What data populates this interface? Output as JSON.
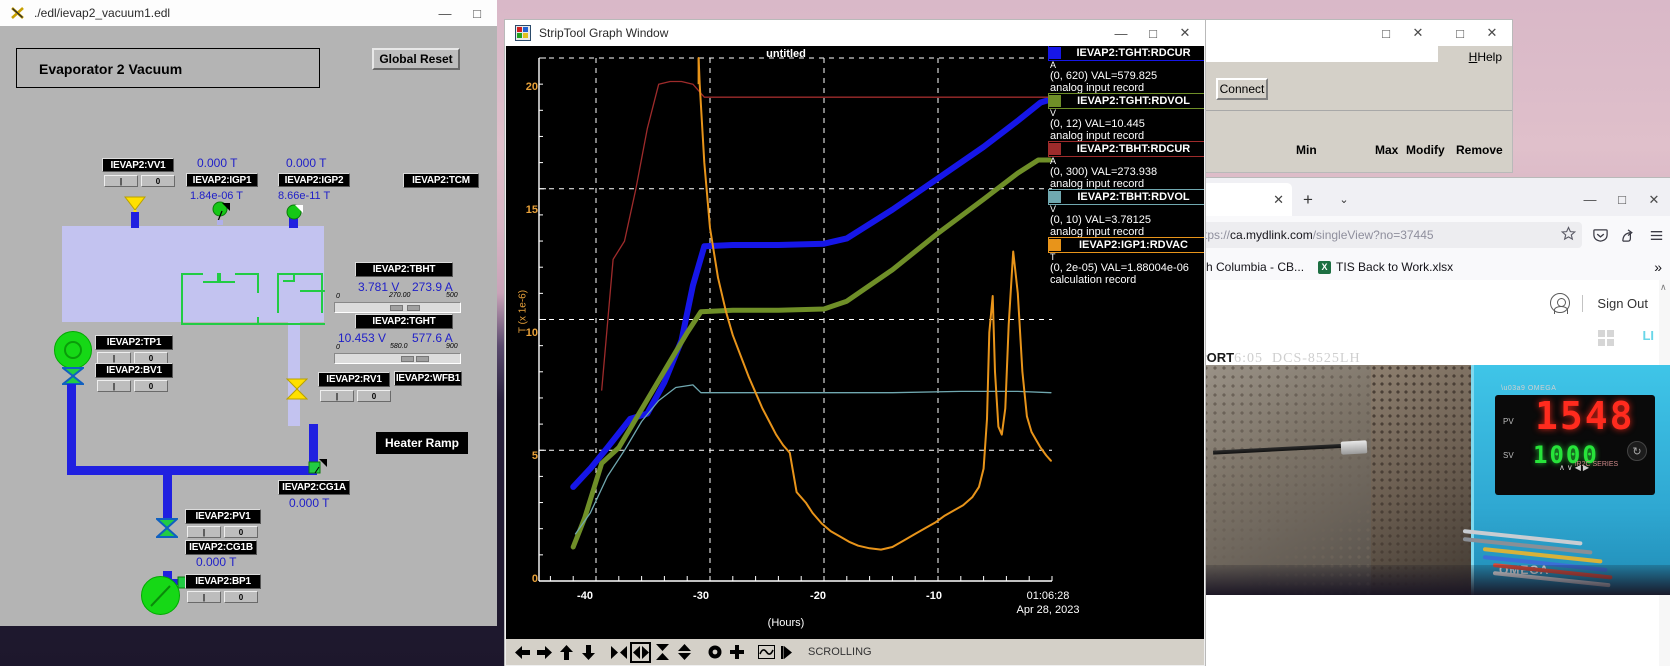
{
  "edm": {
    "title": "./edl/ievap2_vacuum1.edl",
    "icon": "x-window-icon",
    "window_buttons": {
      "minimize": "—",
      "maximize": "□"
    },
    "panel_title": "Evaporator 2 Vacuum",
    "global_reset": "Global Reset",
    "heater_ramp": "Heater Ramp",
    "tags": {
      "vv1": "IEVAP2:VV1",
      "igp1": "IEVAP2:IGP1",
      "igp2": "IEVAP2:IGP2",
      "tcm": "IEVAP2:TCM",
      "tbht": "IEVAP2:TBHT",
      "tght": "IEVAP2:TGHT",
      "wfb1": "IEVAP2:WFB1",
      "tp1": "IEVAP2:TP1",
      "bv1": "IEVAP2:BV1",
      "rv1": "IEVAP2:RV1",
      "cg1a": "IEVAP2:CG1A",
      "cg1b": "IEVAP2:CG1B",
      "pv1": "IEVAP2:PV1",
      "bp1": "IEVAP2:BP1"
    },
    "readings": {
      "vv1_top": "0.000 T",
      "igp1_top": "0.000 T",
      "igp1_val": "1.84e-06 T",
      "igp2_val": "8.66e-11 T",
      "tbht_volt": "3.781 V",
      "tbht_curr": "273.9 A",
      "tbht_scale_min": "0",
      "tbht_scale_mid": "270.00",
      "tbht_scale_max": "500",
      "tght_volt": "10.453 V",
      "tght_curr": "577.6 A",
      "tght_scale_min": "0",
      "tght_scale_mid": "580.0",
      "tght_scale_max": "900",
      "cg1a_val": "0.000 T",
      "cg1b_val": "0.000 T"
    },
    "toggle": {
      "on": "|",
      "off": "0"
    }
  },
  "striptool": {
    "title": "StripTool Graph Window",
    "icon": "striptool-icon",
    "window_buttons": {
      "minimize": "—",
      "maximize": "□",
      "close": "✕"
    },
    "plot_title": "untitled",
    "status": "SCROLLING",
    "toolbar_icons": [
      "arrow-left-icon",
      "arrow-right-icon",
      "arrow-up-icon",
      "arrow-down-icon",
      "collapse-horizontal-icon",
      "expand-horizontal-icon",
      "collapse-vertical-icon",
      "expand-vertical-icon",
      "ring-icon",
      "plus-icon",
      "autoscale-icon",
      "jump-to-end-icon"
    ],
    "legend": [
      {
        "name": "IEVAP2:TGHT:RDCUR",
        "unit": "A",
        "range": "(0, 620)",
        "value": "VAL=579.825",
        "record": "analog input record",
        "color": "#1616e8"
      },
      {
        "name": "IEVAP2:TGHT:RDVOL",
        "unit": "V",
        "range": "(0, 12)",
        "value": "VAL=10.445",
        "record": "analog input record",
        "color": "#6f8f28"
      },
      {
        "name": "IEVAP2:TBHT:RDCUR",
        "unit": "A",
        "range": "(0, 300)",
        "value": "VAL=273.938",
        "record": "analog input record",
        "color": "#9e2b2b"
      },
      {
        "name": "IEVAP2:TBHT:RDVOL",
        "unit": "V",
        "range": "(0, 10)",
        "value": "VAL=3.78125",
        "record": "analog input record",
        "color": "#70a8b0"
      },
      {
        "name": "IEVAP2:IGP1:RDVAC",
        "unit": "T",
        "range": "(0, 2e-05)",
        "value": "VAL=1.88004e-06",
        "record": "calculation record",
        "color": "#e8941a"
      }
    ]
  },
  "chart_data": {
    "type": "line",
    "title": "untitled",
    "xlabel": "(Hours)",
    "ylabel": "T (x 1e-6)",
    "xlim": [
      -45,
      0
    ],
    "ylim": [
      0,
      20
    ],
    "xticks": [
      "-40",
      "-30",
      "-20",
      "-10"
    ],
    "yticks": [
      "0",
      "5",
      "10",
      "15",
      "20"
    ],
    "grid": true,
    "legend_position": "right",
    "end_time": "01:06:28",
    "end_date": "Apr 28, 2023",
    "series": [
      {
        "name": "IEVAP2:TGHT:RDCUR",
        "color": "#1616e8",
        "unit": "A",
        "range": [
          0,
          620
        ],
        "last_value": 579.825,
        "x": [
          -42.0,
          -40.5,
          -39.0,
          -37.0,
          -35.5,
          -34.0,
          -32.5,
          -31.5,
          -30.5,
          -28.0,
          -24.0,
          -20.0,
          -18.0,
          -14.0,
          -10.0,
          -6.0,
          -3.0,
          -1.0,
          -0.2
        ],
        "y": [
          3.6,
          4.3,
          5.1,
          6.2,
          6.4,
          7.6,
          9.2,
          11.3,
          12.8,
          12.85,
          12.85,
          12.9,
          13.1,
          14.2,
          15.4,
          16.6,
          17.6,
          18.3,
          18.4
        ]
      },
      {
        "name": "IEVAP2:TGHT:RDVOL",
        "color": "#6f8f28",
        "unit": "V",
        "range": [
          0,
          12
        ],
        "last_value": 10.445,
        "x": [
          -42.0,
          -41.0,
          -39.5,
          -38.0,
          -36.5,
          -35.0,
          -33.5,
          -32.0,
          -30.8,
          -28.0,
          -24.0,
          -20.0,
          -18.0,
          -14.0,
          -10.0,
          -6.0,
          -3.0,
          -1.2,
          -0.2
        ],
        "y": [
          1.3,
          2.4,
          4.5,
          5.1,
          6.2,
          7.3,
          8.4,
          9.5,
          10.3,
          10.35,
          10.35,
          10.4,
          10.7,
          11.9,
          13.3,
          14.6,
          15.6,
          16.1,
          16.1
        ]
      },
      {
        "name": "IEVAP2:TBHT:RDCUR",
        "color": "#9e2b2b",
        "unit": "A",
        "range": [
          0,
          300
        ],
        "last_value": 273.938,
        "x": [
          -39.5,
          -38.5,
          -37.5,
          -36.5,
          -35.5,
          -34.5,
          -33.5,
          -32.5,
          -31.5,
          -30.5,
          -28.0,
          -20.0,
          -10.0,
          -1.0,
          -0.1
        ],
        "y": [
          7.3,
          12.3,
          13.0,
          15.0,
          17.3,
          19.0,
          19.1,
          19.1,
          19.0,
          18.5,
          18.5,
          18.5,
          18.5,
          18.5,
          18.5
        ]
      },
      {
        "name": "IEVAP2:TBHT:RDVOL",
        "color": "#70a8b0",
        "unit": "V",
        "range": [
          0,
          10
        ],
        "last_value": 3.78125,
        "x": [
          -41.8,
          -40.5,
          -39.0,
          -37.5,
          -36.0,
          -34.5,
          -33.0,
          -31.5,
          -30.8,
          -28.0,
          -20.0,
          -14.0,
          -8.0,
          -3.0,
          -0.1
        ],
        "y": [
          1.8,
          2.6,
          4.0,
          5.0,
          6.1,
          6.9,
          7.4,
          7.5,
          7.2,
          7.2,
          7.2,
          7.2,
          7.25,
          7.25,
          7.2
        ]
      },
      {
        "name": "IEVAP2:IGP1:RDVAC",
        "color": "#e8941a",
        "unit": "T",
        "range": [
          0,
          2e-05
        ],
        "last_value": 1.88004e-06,
        "x": [
          -31.0,
          -30.9,
          -30.5,
          -30.0,
          -29.3,
          -28.6,
          -28.0,
          -27.3,
          -26.6,
          -26.0,
          -25.4,
          -24.8,
          -24.2,
          -23.6,
          -23.0,
          -22.4,
          -21.6,
          -21.0,
          -20.2,
          -19.4,
          -18.6,
          -17.8,
          -17.0,
          -16.0,
          -15.0,
          -14.0,
          -13.0,
          -12.0,
          -11.0,
          -10.2,
          -9.4,
          -8.6,
          -7.8,
          -7.0,
          -6.4,
          -6.0,
          -5.7,
          -5.5,
          -5.2,
          -5.0,
          -4.7,
          -4.4,
          -4.1,
          -3.8,
          -3.4,
          -3.0,
          -2.6,
          -2.2,
          -1.8,
          -1.4,
          -1.0,
          -0.5,
          -0.1
        ],
        "y": [
          20.0,
          19.0,
          16.0,
          13.5,
          11.6,
          10.3,
          9.4,
          8.6,
          7.8,
          7.2,
          6.6,
          6.1,
          5.6,
          5.2,
          4.9,
          3.4,
          3.0,
          2.6,
          2.2,
          1.9,
          1.7,
          1.5,
          1.35,
          1.25,
          1.2,
          1.3,
          1.55,
          1.8,
          2.05,
          2.25,
          2.5,
          2.7,
          2.9,
          3.2,
          3.6,
          4.3,
          6.2,
          9.5,
          10.9,
          8.0,
          5.9,
          5.6,
          6.6,
          9.8,
          12.6,
          11.0,
          8.0,
          6.3,
          5.7,
          5.4,
          5.1,
          4.8,
          4.6
        ]
      }
    ]
  },
  "channel_window": {
    "title": "",
    "window_buttons": {
      "minimize": "—",
      "maximize": "□",
      "close": "✕"
    },
    "help_label": "Help",
    "connect_label": "Connect",
    "columns": [
      "Min",
      "Max",
      "Modify",
      "Remove"
    ]
  },
  "fragment_window": {
    "window_buttons": {
      "maximize": "□",
      "close": "✕"
    }
  },
  "browser": {
    "tab_close": "✕",
    "new_tab": "+",
    "list_all_tabs": "⌄",
    "window_buttons": {
      "minimize": "—",
      "maximize": "□",
      "close": "✕"
    },
    "url_prefix": "tps://",
    "url_host": "ca.mydlink.com",
    "url_path": "/singleView?no=37445",
    "icons": {
      "bookmark": "star-icon",
      "pocket": "pocket-icon",
      "share": "share-icon",
      "menu": "hamburger-menu-icon"
    },
    "bookmarks": [
      {
        "label": "sh Columbia - CB...",
        "icon": ""
      },
      {
        "label": "TIS Back to Work.xlsx",
        "icon": "excel-icon",
        "icon_letter": "X"
      }
    ],
    "bookmarks_overflow": "»",
    "page": {
      "sign_out": "Sign Out",
      "avatar": "user-avatar-icon",
      "grid_icon": "grid-view-icon",
      "camera_label_bold": "PORT",
      "camera_label_time": "6:05",
      "camera_label_model": "DCS-8525LH",
      "scroll_up": "∧"
    }
  },
  "webcam": {
    "omega_brand": "OMEGA",
    "series_text": "iR2C SERIES",
    "pv_label": "PV",
    "sv_label": "SV",
    "pv_value": "1548",
    "sv_value": "1000",
    "knob_icon": "reset-knob-icon",
    "arrows": "∧∨◀▶"
  }
}
